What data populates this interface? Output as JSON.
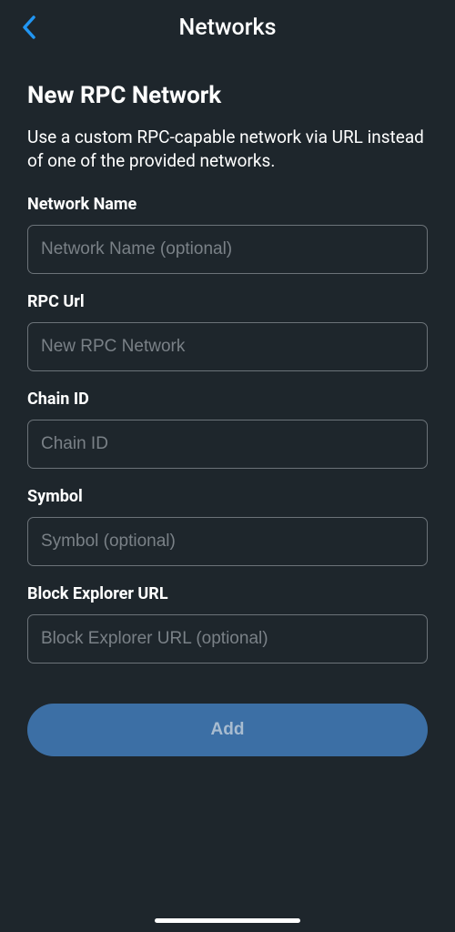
{
  "header": {
    "title": "Networks"
  },
  "page": {
    "title": "New RPC Network",
    "description": "Use a custom RPC-capable network via URL instead of one of the provided networks."
  },
  "form": {
    "networkName": {
      "label": "Network Name",
      "placeholder": "Network Name (optional)"
    },
    "rpcUrl": {
      "label": "RPC Url",
      "placeholder": "New RPC Network"
    },
    "chainId": {
      "label": "Chain ID",
      "placeholder": "Chain ID"
    },
    "symbol": {
      "label": "Symbol",
      "placeholder": "Symbol (optional)"
    },
    "blockExplorerUrl": {
      "label": "Block Explorer URL",
      "placeholder": "Block Explorer URL (optional)"
    }
  },
  "actions": {
    "addButton": "Add"
  }
}
